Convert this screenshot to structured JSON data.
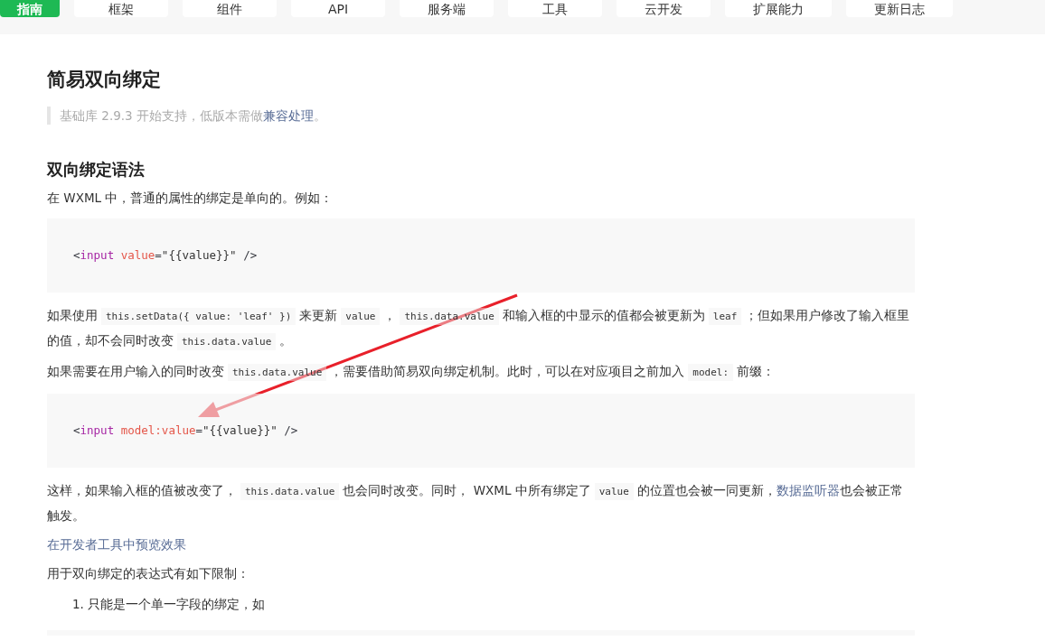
{
  "nav": {
    "tabs": [
      {
        "label": "指南",
        "selected": true
      },
      {
        "label": "框架",
        "selected": false
      },
      {
        "label": "组件",
        "selected": false
      },
      {
        "label": "API",
        "selected": false
      },
      {
        "label": "服务端",
        "selected": false
      },
      {
        "label": "工具",
        "selected": false
      },
      {
        "label": "云开发",
        "selected": false
      },
      {
        "label": "扩展能力",
        "selected": false
      },
      {
        "label": "更新日志",
        "selected": false
      }
    ]
  },
  "content": [
    {
      "kind": "h2",
      "text": "简易双向绑定"
    },
    {
      "kind": "note",
      "segments": [
        {
          "kind": "text",
          "text": "基础库 2.9.3 开始支持，低版本需做"
        },
        {
          "kind": "link",
          "text": "兼容处理"
        },
        {
          "kind": "text",
          "text": "。"
        }
      ]
    },
    {
      "kind": "h3",
      "text": "双向绑定语法"
    },
    {
      "kind": "p",
      "segments": [
        {
          "kind": "text",
          "text": "在 WXML 中，普通的属性的绑定是单向的。例如："
        }
      ]
    },
    {
      "kind": "code",
      "tokens": [
        {
          "kind": "punct",
          "text": "<"
        },
        {
          "kind": "tag",
          "text": "input"
        },
        {
          "kind": "attr",
          "text": " value"
        },
        {
          "kind": "punct",
          "text": "="
        },
        {
          "kind": "string",
          "text": "\"{{value}}\""
        },
        {
          "kind": "punct",
          "text": " />"
        }
      ]
    },
    {
      "kind": "p",
      "segments": [
        {
          "kind": "text",
          "text": "如果使用"
        },
        {
          "kind": "code",
          "text": "this.setData({ value: 'leaf' })"
        },
        {
          "kind": "text",
          "text": "来更新"
        },
        {
          "kind": "code",
          "text": "value"
        },
        {
          "kind": "text",
          "text": "，"
        },
        {
          "kind": "code",
          "text": "this.data.value"
        },
        {
          "kind": "text",
          "text": "和输入框的中显示的值都会被更新为"
        },
        {
          "kind": "code",
          "text": "leaf"
        },
        {
          "kind": "text",
          "text": "；但如果用户修改了输入框里的值，却不会同时改变"
        },
        {
          "kind": "code",
          "text": "this.data.value"
        },
        {
          "kind": "text",
          "text": "。"
        }
      ]
    },
    {
      "kind": "p",
      "segments": [
        {
          "kind": "text",
          "text": "如果需要在用户输入的同时改变"
        },
        {
          "kind": "code",
          "text": "this.data.value"
        },
        {
          "kind": "text",
          "text": "，需要借助简易双向绑定机制。此时，可以在对应项目之前加入"
        },
        {
          "kind": "code",
          "text": "model:"
        },
        {
          "kind": "text",
          "text": "前缀："
        }
      ]
    },
    {
      "kind": "code",
      "tokens": [
        {
          "kind": "punct",
          "text": "<"
        },
        {
          "kind": "tag",
          "text": "input"
        },
        {
          "kind": "attr",
          "text": " model:value"
        },
        {
          "kind": "punct",
          "text": "="
        },
        {
          "kind": "string",
          "text": "\"{{value}}\""
        },
        {
          "kind": "punct",
          "text": " />"
        }
      ]
    },
    {
      "kind": "p",
      "segments": [
        {
          "kind": "text",
          "text": "这样，如果输入框的值被改变了，"
        },
        {
          "kind": "code",
          "text": "this.data.value"
        },
        {
          "kind": "text",
          "text": "也会同时改变。同时， WXML 中所有绑定了"
        },
        {
          "kind": "code",
          "text": "value"
        },
        {
          "kind": "text",
          "text": "的位置也会被一同更新，"
        },
        {
          "kind": "link",
          "text": "数据监听器"
        },
        {
          "kind": "text",
          "text": "也会被正常触发。"
        }
      ]
    },
    {
      "kind": "p",
      "segments": [
        {
          "kind": "link",
          "text": "在开发者工具中预览效果"
        }
      ]
    },
    {
      "kind": "p",
      "segments": [
        {
          "kind": "text",
          "text": "用于双向绑定的表达式有如下限制："
        }
      ]
    },
    {
      "kind": "ol",
      "items": [
        {
          "number": "1.",
          "text": "只能是一个单一字段的绑定，如"
        }
      ]
    },
    {
      "kind": "code"
    }
  ]
}
